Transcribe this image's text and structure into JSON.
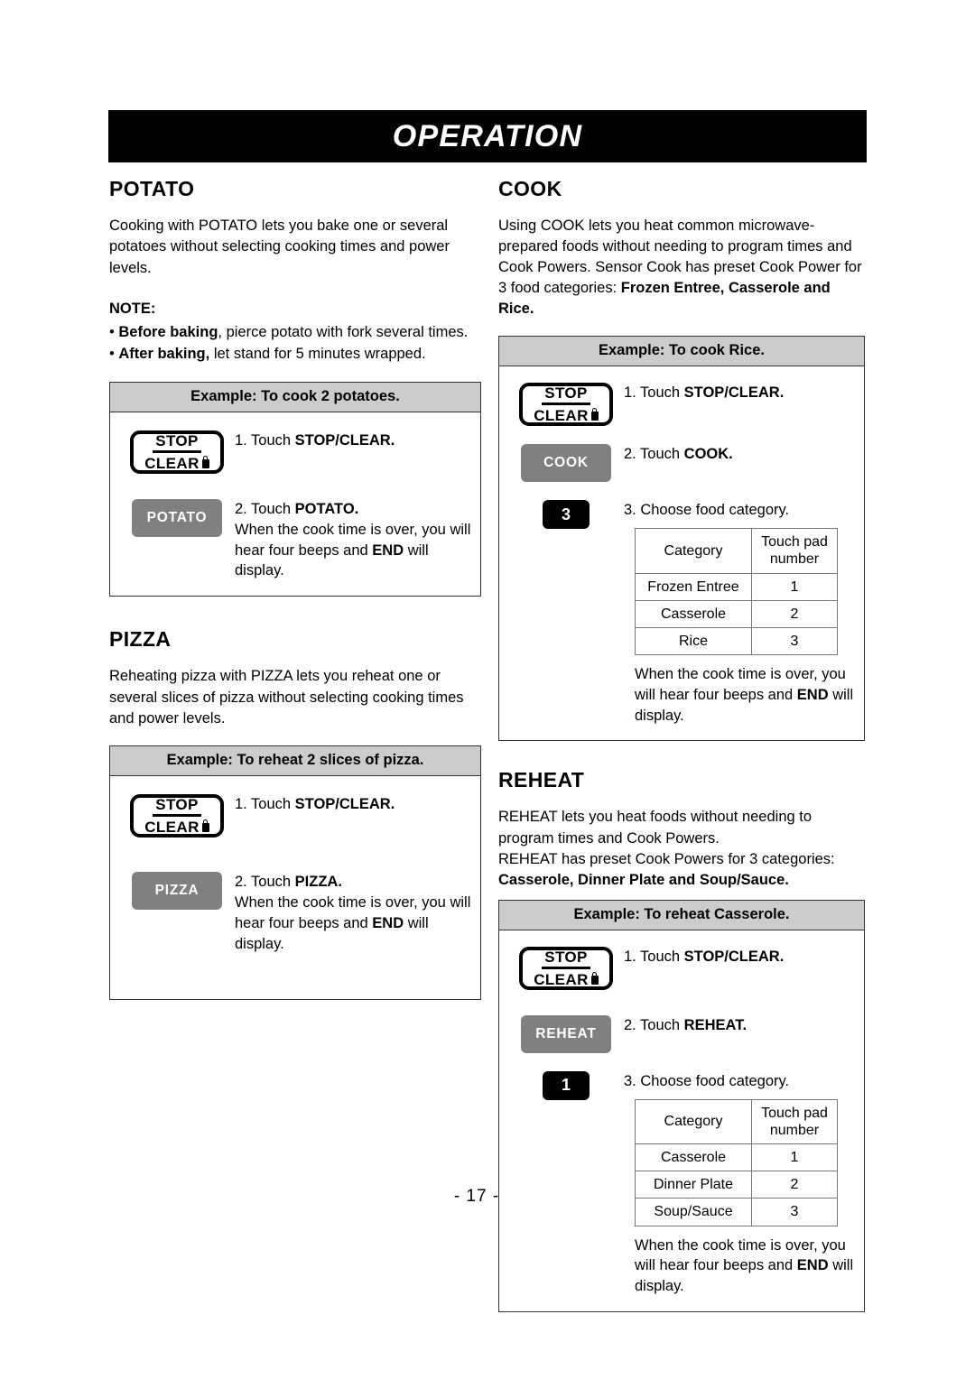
{
  "banner": {
    "title": "OPERATION"
  },
  "page_number": "- 17 -",
  "potato": {
    "heading": "POTATO",
    "intro": "Cooking with POTATO lets you bake one or several potatoes without selecting cooking times and power levels.",
    "note_heading": "NOTE:",
    "notes": [
      {
        "bullet": "• ",
        "bold": "Before baking",
        "rest": ", pierce potato with fork several times."
      },
      {
        "bullet": "• ",
        "bold": "After baking,",
        "rest": " let stand for 5 minutes wrapped."
      }
    ],
    "example_title": "Example: To cook 2 potatoes.",
    "steps": [
      {
        "num": "1. Touch ",
        "bold": "STOP/CLEAR.",
        "key": "stop-clear"
      },
      {
        "num": "2. Touch ",
        "bold": "POTATO.",
        "key": "POTATO"
      }
    ],
    "closing_pre": "When the cook time is over, you will hear four beeps and ",
    "closing_bold": "END",
    "closing_post": " will display."
  },
  "pizza": {
    "heading": "PIZZA",
    "intro": "Reheating pizza with PIZZA lets you reheat one or several slices of pizza without selecting cooking times and power levels.",
    "example_title": "Example: To reheat 2 slices of pizza.",
    "steps": [
      {
        "num": "1. Touch ",
        "bold": "STOP/CLEAR.",
        "key": "stop-clear"
      },
      {
        "num": "2. Touch ",
        "bold": "PIZZA.",
        "key": "PIZZA"
      }
    ],
    "closing_pre": "When the cook time is over, you will hear four beeps and ",
    "closing_bold": "END",
    "closing_post": " will display."
  },
  "cook": {
    "heading": "COOK",
    "intro_pre": "Using  COOK lets you heat common microwave-prepared foods without needing to program times and Cook Powers. Sensor Cook has preset Cook Power for 3 food categories: ",
    "intro_bold": "Frozen Entree, Casserole and Rice.",
    "example_title": "Example: To cook Rice.",
    "steps": [
      {
        "num": "1. Touch ",
        "bold": "STOP/CLEAR.",
        "key": "stop-clear"
      },
      {
        "num": "2. Touch ",
        "bold": "COOK.",
        "key": "COOK"
      },
      {
        "num": "3. Choose food category.",
        "bold": "",
        "key": "3"
      }
    ],
    "table": {
      "headers": [
        "Category",
        "Touch pad number"
      ],
      "header_col2_line1": "Touch pad",
      "header_col2_line2": "number",
      "rows": [
        {
          "category": "Frozen Entree",
          "number": "1"
        },
        {
          "category": "Casserole",
          "number": "2"
        },
        {
          "category": "Rice",
          "number": "3"
        }
      ]
    },
    "closing_pre": "When the cook time is over, you will hear four beeps and ",
    "closing_bold": "END",
    "closing_post": " will display."
  },
  "reheat": {
    "heading": "REHEAT",
    "intro_line1": "REHEAT lets you heat foods without needing to program times and Cook Powers.",
    "intro_line2_pre": "REHEAT has preset Cook Powers for 3 categories: ",
    "intro_bold": "Casserole, Dinner Plate and Soup/Sauce.",
    "example_title": "Example: To reheat Casserole.",
    "steps": [
      {
        "num": "1. Touch ",
        "bold": "STOP/CLEAR.",
        "key": "stop-clear"
      },
      {
        "num": "2. Touch ",
        "bold": "REHEAT.",
        "key": "REHEAT"
      },
      {
        "num": "3. Choose food category.",
        "bold": "",
        "key": "1"
      }
    ],
    "table": {
      "headers": [
        "Category",
        "Touch pad number"
      ],
      "header_col2_line1": "Touch pad",
      "header_col2_line2": "number",
      "rows": [
        {
          "category": "Casserole",
          "number": "1"
        },
        {
          "category": "Dinner Plate",
          "number": "2"
        },
        {
          "category": "Soup/Sauce",
          "number": "3"
        }
      ]
    },
    "closing_pre": "When the cook time is over, you will hear four beeps and ",
    "closing_bold": "END",
    "closing_post": " will display."
  },
  "keys": {
    "stop_label": "STOP",
    "clear_label": "CLEAR",
    "potato_label": "POTATO",
    "pizza_label": "PIZZA",
    "cook_label": "COOK",
    "reheat_label": "REHEAT",
    "num_three": "3",
    "num_one": "1"
  },
  "colors": {
    "banner_bg": "#000000",
    "example_header_bg": "#cccccc",
    "gray_key_bg": "#808080",
    "black_key_bg": "#000000",
    "border": "#333333"
  }
}
